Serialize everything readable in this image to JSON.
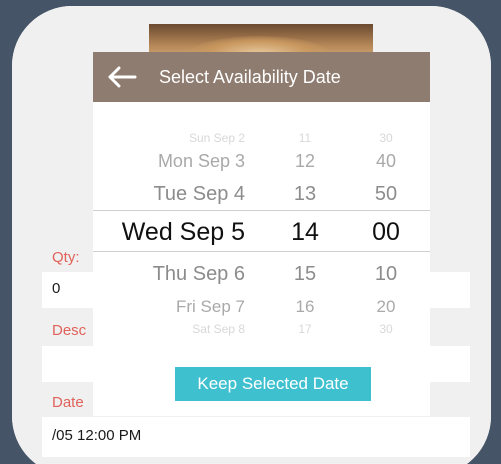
{
  "form": {
    "qty_label": "Qty:",
    "qty_value": "0",
    "desc_label": "Desc",
    "desc_value": "",
    "date_label": "Date",
    "date_value": "/05 12:00 PM"
  },
  "modal": {
    "title": "Select Availability Date",
    "keep_button_label": "Keep Selected Date"
  },
  "picker": {
    "days": [
      "Sun Sep 2",
      "Mon Sep 3",
      "Tue Sep 4",
      "Wed Sep 5",
      "Thu Sep 6",
      "Fri Sep 7",
      "Sat Sep 8"
    ],
    "hours": [
      "11",
      "12",
      "13",
      "14",
      "15",
      "16",
      "17"
    ],
    "minutes": [
      "30",
      "40",
      "50",
      "00",
      "10",
      "20",
      "30"
    ],
    "selected": {
      "day": "Wed Sep 5",
      "hour": "14",
      "minute": "00"
    }
  },
  "colors": {
    "header": "#8f7c70",
    "button": "#3ec0cf",
    "field_label": "#e0625a",
    "outer_background": "#455467"
  },
  "icons": {
    "back": "back-arrow-icon"
  }
}
